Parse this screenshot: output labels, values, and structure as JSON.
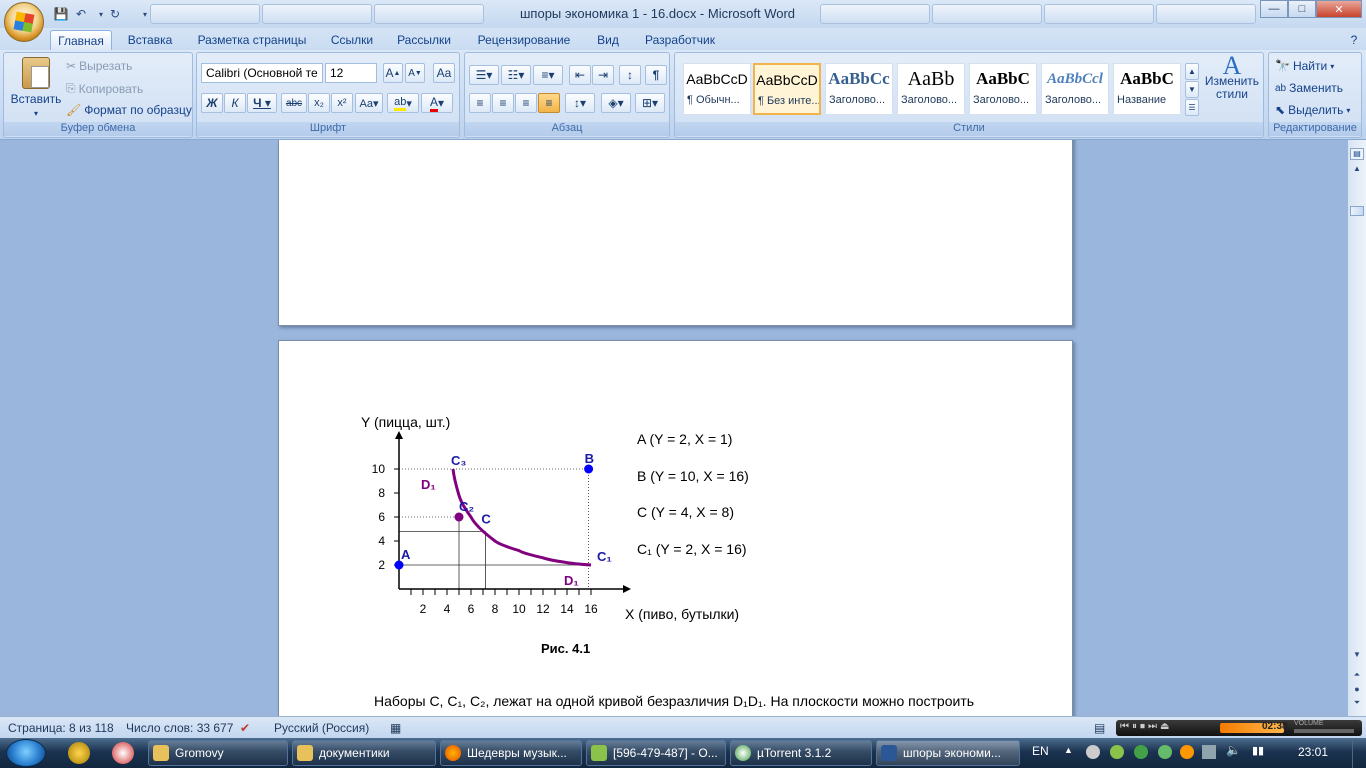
{
  "window": {
    "title": "шпоры экономика 1 - 16.docx - Microsoft Word",
    "tabs_top": [
      "",
      "",
      "",
      "",
      "",
      "",
      "",
      "",
      ""
    ],
    "controls": {
      "minimize": "—",
      "maximize": "□",
      "close": "✕"
    }
  },
  "menu": {
    "tabs": [
      "Главная",
      "Вставка",
      "Разметка страницы",
      "Ссылки",
      "Рассылки",
      "Рецензирование",
      "Вид",
      "Разработчик"
    ]
  },
  "ribbon": {
    "clipboard": {
      "paste": "Вставить",
      "cut": "Вырезать",
      "copy": "Копировать",
      "format_painter": "Формат по образцу",
      "label": "Буфер обмена"
    },
    "font": {
      "name": "Calibri (Основной те",
      "size": "12",
      "label": "Шрифт"
    },
    "paragraph": {
      "label": "Абзац"
    },
    "styles": {
      "items": [
        {
          "preview": "AaBbCcD",
          "name": "¶ Обычн..."
        },
        {
          "preview": "AaBbCcD",
          "name": "¶ Без инте..."
        },
        {
          "preview": "AaBbCc",
          "name": "Заголово..."
        },
        {
          "preview": "AaBb",
          "name": "Заголово..."
        },
        {
          "preview": "AaBbC",
          "name": "Заголово..."
        },
        {
          "preview": "AaBbCcl",
          "name": "Заголово..."
        },
        {
          "preview": "AaBbC",
          "name": "Название"
        }
      ],
      "change": "Изменить стили",
      "label": "Стили"
    },
    "editing": {
      "find": "Найти",
      "replace": "Заменить",
      "select": "Выделить",
      "label": "Редактирование"
    }
  },
  "chart_data": {
    "type": "line",
    "ylabel": "Y (пицца, шт.)",
    "xlabel": "X (пиво, бутылки)",
    "x_ticks": [
      "2",
      "4",
      "6",
      "8",
      "10",
      "12",
      "14",
      "16"
    ],
    "y_ticks": [
      "2",
      "4",
      "6",
      "8",
      "10"
    ],
    "xlim": [
      0,
      18
    ],
    "ylim": [
      0,
      12
    ],
    "curve": {
      "x": [
        4.5,
        5,
        6,
        8,
        10,
        12,
        14,
        16
      ],
      "y": [
        10,
        7.8,
        6,
        4,
        3.2,
        2.6,
        2.2,
        2
      ]
    },
    "points": [
      {
        "label": "A",
        "x": 0,
        "y": 2
      },
      {
        "label": "B",
        "x": 15.8,
        "y": 10
      },
      {
        "label": "C₂",
        "x": 5,
        "y": 6
      },
      {
        "label": "C₃",
        "x": 4.5,
        "y": 10
      },
      {
        "label": "C",
        "x": 7.2,
        "y": 4.8
      },
      {
        "label": "C₁",
        "x": 16,
        "y": 2
      }
    ],
    "curve_labels": [
      "D₁",
      "D₁"
    ],
    "caption": "Рис. 4.1"
  },
  "document": {
    "legend": [
      "A  (Y = 2,  X = 1)",
      "B  (Y = 10,  X = 16)",
      "C  (Y = 4,  X = 8)",
      "C₁ (Y = 2,  X = 16)"
    ],
    "paragraph": "Наборы C, C₁, C₂, лежат на одной кривой безразличия D₁D₁. На плоскости можно построить"
  },
  "status": {
    "page": "Страница: 8 из 118",
    "words": "Число слов: 33 677",
    "language": "Русский (Россия)",
    "time": "02:38",
    "volume_label": "VOLUME"
  },
  "taskbar": {
    "tasks": [
      "Gromovy",
      "документики",
      "Шедевры музык...",
      "[596-479-487] - О...",
      "µTorrent 3.1.2",
      "шпоры экономи..."
    ],
    "lang": "EN",
    "clock": "23:01"
  },
  "colors": {
    "curve": "#800080",
    "points": "#0000ff",
    "ribbon": "#c7daf2"
  }
}
